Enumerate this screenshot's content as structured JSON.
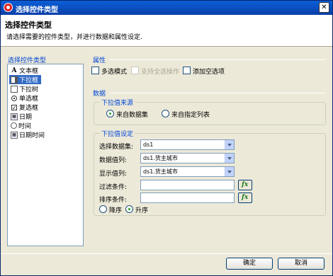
{
  "window": {
    "title": "选择控件类型"
  },
  "header": {
    "title": "选择控件类型",
    "description": "请选择需要的控件类型，并进行数据和属性设定."
  },
  "control_types": {
    "label": "选择控件类型",
    "items": [
      {
        "label": "文本框",
        "icon": "text-icon",
        "selected": false
      },
      {
        "label": "下拉框",
        "icon": "combobox-icon",
        "selected": true
      },
      {
        "label": "下拉树",
        "icon": "tree-icon",
        "selected": false
      },
      {
        "label": "单选框",
        "icon": "radio-icon",
        "selected": false
      },
      {
        "label": "复选框",
        "icon": "checkbox-icon",
        "selected": false
      },
      {
        "label": "日期",
        "icon": "date-icon",
        "selected": false
      },
      {
        "label": "时间",
        "icon": "time-icon",
        "selected": false
      },
      {
        "label": "日期时间",
        "icon": "datetime-icon",
        "selected": false
      }
    ]
  },
  "properties": {
    "label": "属性",
    "multi_select": {
      "label": "多选模式",
      "checked": false
    },
    "select_all": {
      "label": "支持全选操作",
      "checked": false,
      "enabled": false
    },
    "add_empty": {
      "label": "添加空选项",
      "checked": false
    }
  },
  "data": {
    "label": "数据",
    "source": {
      "label": "下拉值来源",
      "option_dataset": {
        "label": "来自数据集",
        "checked": true
      },
      "option_list": {
        "label": "来自指定列表",
        "checked": false
      }
    },
    "settings": {
      "label": "下拉值设定",
      "dataset_label": "选择数据集:",
      "dataset_value": "ds1",
      "data_column_label": "数据值列:",
      "data_column_value": "ds1.货主城市",
      "display_column_label": "显示值列:",
      "display_column_value": "ds1.货主城市",
      "filter_label": "过滤条件:",
      "filter_value": "",
      "sort_label": "排序条件:",
      "sort_value": "",
      "fx_label": "fx",
      "sort_desc": {
        "label": "降序",
        "checked": false
      },
      "sort_asc": {
        "label": "升序",
        "checked": true
      }
    }
  },
  "footer": {
    "ok_label": "确定",
    "cancel_label": "取消"
  },
  "colors": {
    "title_bar": "#0b3fa8",
    "group_label": "#0046d5",
    "selection": "#316ac5"
  }
}
